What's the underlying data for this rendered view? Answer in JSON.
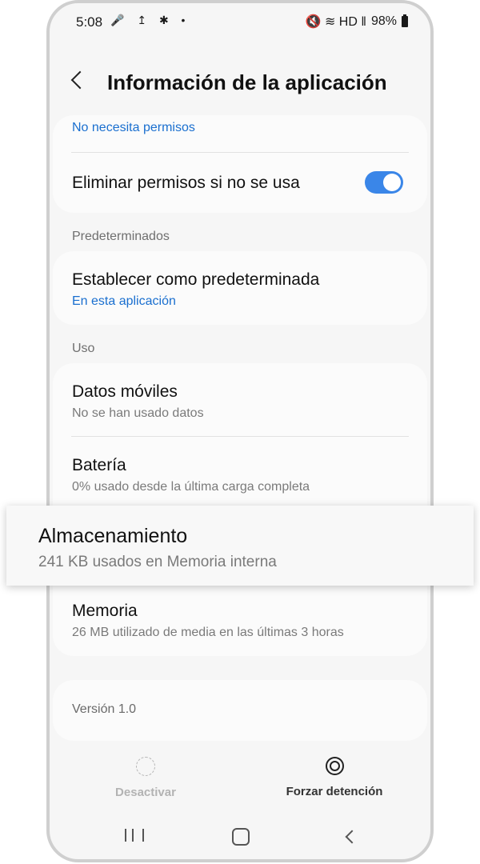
{
  "status": {
    "time": "5:08",
    "left_icons": "🎤 ↥ ✱ •",
    "right_icons": "🔇 ≋ HD ‖",
    "battery": "98%"
  },
  "header": {
    "title": "Información de la aplicación"
  },
  "permissions": {
    "summary": "No necesita permisos",
    "remove_label": "Eliminar permisos si no se usa",
    "remove_enabled": true
  },
  "defaults": {
    "section": "Predeterminados",
    "title": "Establecer como predeterminada",
    "sub": "En esta aplicación"
  },
  "usage": {
    "section": "Uso",
    "items": [
      {
        "title": "Datos móviles",
        "sub": "No se han usado datos"
      },
      {
        "title": "Batería",
        "sub": "0% usado desde la última carga completa"
      },
      {
        "title": "Almacenamiento",
        "sub": "241 KB usados en Memoria interna"
      },
      {
        "title": "Memoria",
        "sub": "26 MB utilizado de media en las últimas 3 horas"
      }
    ]
  },
  "version": "Versión 1.0",
  "actions": {
    "disable": "Desactivar",
    "force_stop": "Forzar detención"
  }
}
